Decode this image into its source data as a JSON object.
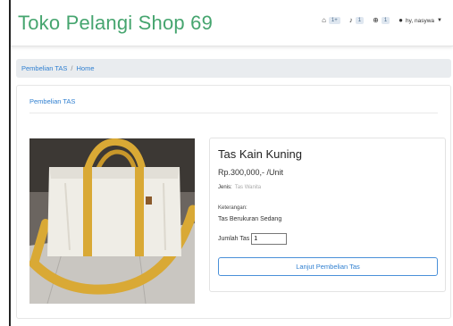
{
  "navbar": {
    "brand": "Toko Pelangi Shop 69",
    "items": [
      {
        "icon": "home-icon",
        "badge": "1+"
      },
      {
        "icon": "bell-icon",
        "badge": "1"
      },
      {
        "icon": "cart-icon",
        "badge": "1"
      }
    ],
    "user": {
      "icon": "user-icon",
      "name": "hy, nasywa"
    }
  },
  "breadcrumb": {
    "items": [
      "Pembelian TAS",
      "Home"
    ],
    "separator": "/"
  },
  "card": {
    "header": "Pembelian TAS"
  },
  "product": {
    "name": "Tas Kain Kuning",
    "price": "Rp.300,000,- /Unit",
    "jenis_label": "Jenis:",
    "jenis_value": "Tas Wanita",
    "keterangan_label": "Keterangan:",
    "keterangan_value": "Tas Berukuran Sedang",
    "qty_label": "Jumlah Tas",
    "qty_value": "1",
    "buy_label": "Lanjut Pembelian Tas"
  },
  "colors": {
    "brand": "#46a56f",
    "link": "#2f7fd0",
    "bag_yellow": "#d9a935",
    "bag_canvas": "#efede6"
  }
}
